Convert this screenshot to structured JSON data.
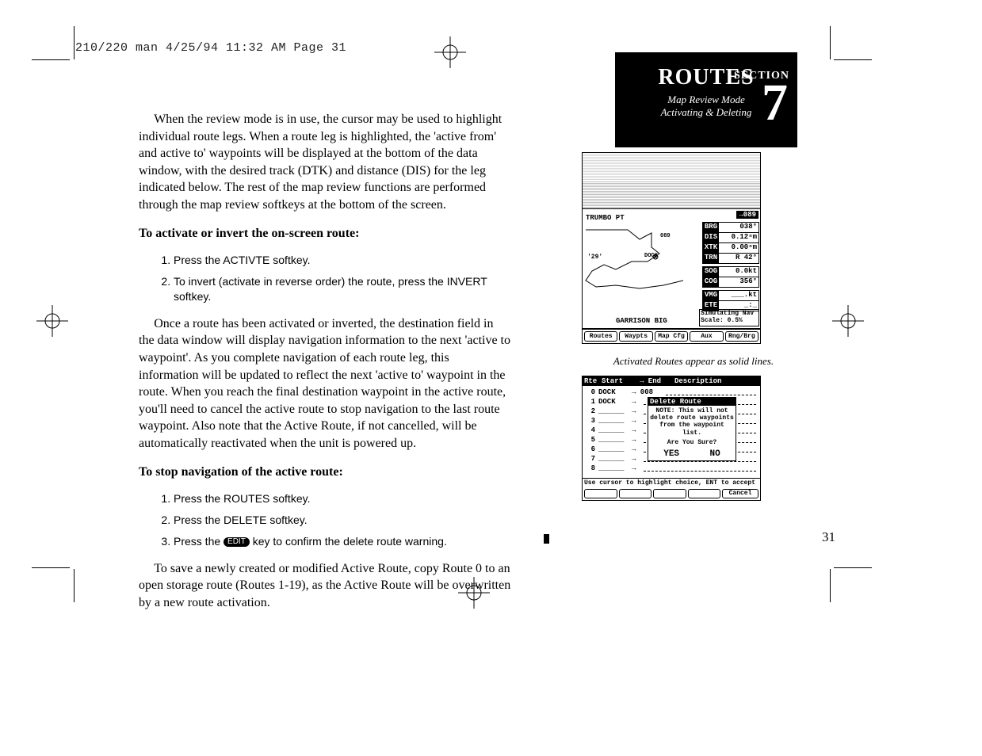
{
  "header": "210/220 man  4/25/94 11:32 AM  Page 31",
  "page_number": "31",
  "section_box": {
    "title": "ROUTES",
    "section_word": "SECTION",
    "number": "7",
    "subtitle_line1": "Map Review Mode",
    "subtitle_line2": "Activating & Deleting"
  },
  "body": {
    "p1": "When the review mode is in use, the cursor may be used to highlight individual route legs. When a route leg is highlighted, the 'active from' and active to' waypoints will be displayed at the bottom of the data window, with the desired track (DTK) and distance (DIS) for the leg indicated below. The rest of the map review functions are performed through the map review softkeys at the bottom of the screen.",
    "h1": "To activate or invert the on-screen route:",
    "l1a": "Press the ACTIVTE softkey.",
    "l1b": "To invert (activate in reverse order) the route, press the INVERT softkey.",
    "p2": "Once a route has been activated or inverted, the destination field in the data window will display navigation information to the next 'active to waypoint'. As you complete navigation of each route leg, this information will be updated to reflect the next 'active to' waypoint in the route. When you reach the final destination waypoint in the active route, you'll need to cancel the active route to stop navigation to the last route waypoint. Also note that the Active Route, if not cancelled, will be automatically reactivated when the unit is powered up.",
    "h2": "To stop navigation of the active route:",
    "l2a": "Press the ROUTES softkey.",
    "l2b": "Press the DELETE softkey.",
    "l2c_pre": "Press the ",
    "l2c_badge": "EDIT",
    "l2c_post": " key to confirm the delete route warning.",
    "p3": "To save a newly created or modified Active Route, copy Route 0 to an open storage route (Routes 1-19), as the Active Route will be overwritten by a new route activation."
  },
  "map_screen": {
    "badge": "→089",
    "label_top": "TRUMBO PT",
    "label_mid": "'29'",
    "label_dock": "DOCK",
    "label_089": "089",
    "label_bottom": "GARRISON BIG",
    "rows": [
      {
        "tag": "BRG",
        "val": "038°"
      },
      {
        "tag": "DIS",
        "val": "0.12ⁿm"
      },
      {
        "tag": "XTK",
        "val": "0.00ⁿm"
      },
      {
        "tag": "TRN",
        "val": "R 42°"
      },
      {
        "tag": "SOG",
        "val": "0.0kt"
      },
      {
        "tag": "COG",
        "val": "356°"
      },
      {
        "tag": "VMG",
        "val": "___.kt"
      },
      {
        "tag": "ETE",
        "val": "_:_"
      }
    ],
    "sim1": "Simulating Nav",
    "sim2": "Scale:  0.5%",
    "softkeys": [
      "Routes",
      "Waypts",
      "Map Cfg",
      "Aux",
      "Rng/Brg"
    ],
    "caption": "Activated Routes appear as solid lines."
  },
  "delete_screen": {
    "head": [
      "Rte",
      "Start",
      "→ End",
      "Description"
    ],
    "rows": [
      {
        "n": "0",
        "a": "DOCK",
        "b": "→ 008"
      },
      {
        "n": "1",
        "a": "DOCK",
        "b": ""
      },
      {
        "n": "2",
        "a": "______",
        "b": ""
      },
      {
        "n": "3",
        "a": "______",
        "b": ""
      },
      {
        "n": "4",
        "a": "______",
        "b": ""
      },
      {
        "n": "5",
        "a": "______",
        "b": ""
      },
      {
        "n": "6",
        "a": "______",
        "b": ""
      },
      {
        "n": "7",
        "a": "______",
        "b": ""
      },
      {
        "n": "8",
        "a": "______",
        "b": ""
      }
    ],
    "popup_title": "Delete Route",
    "popup_body": "NOTE: This will not delete route waypoints from the waypoint list.",
    "popup_q": "Are You Sure?",
    "yes": "YES",
    "no": "NO",
    "footer": "Use cursor to highlight choice, ENT to accept",
    "cancel": "Cancel"
  }
}
